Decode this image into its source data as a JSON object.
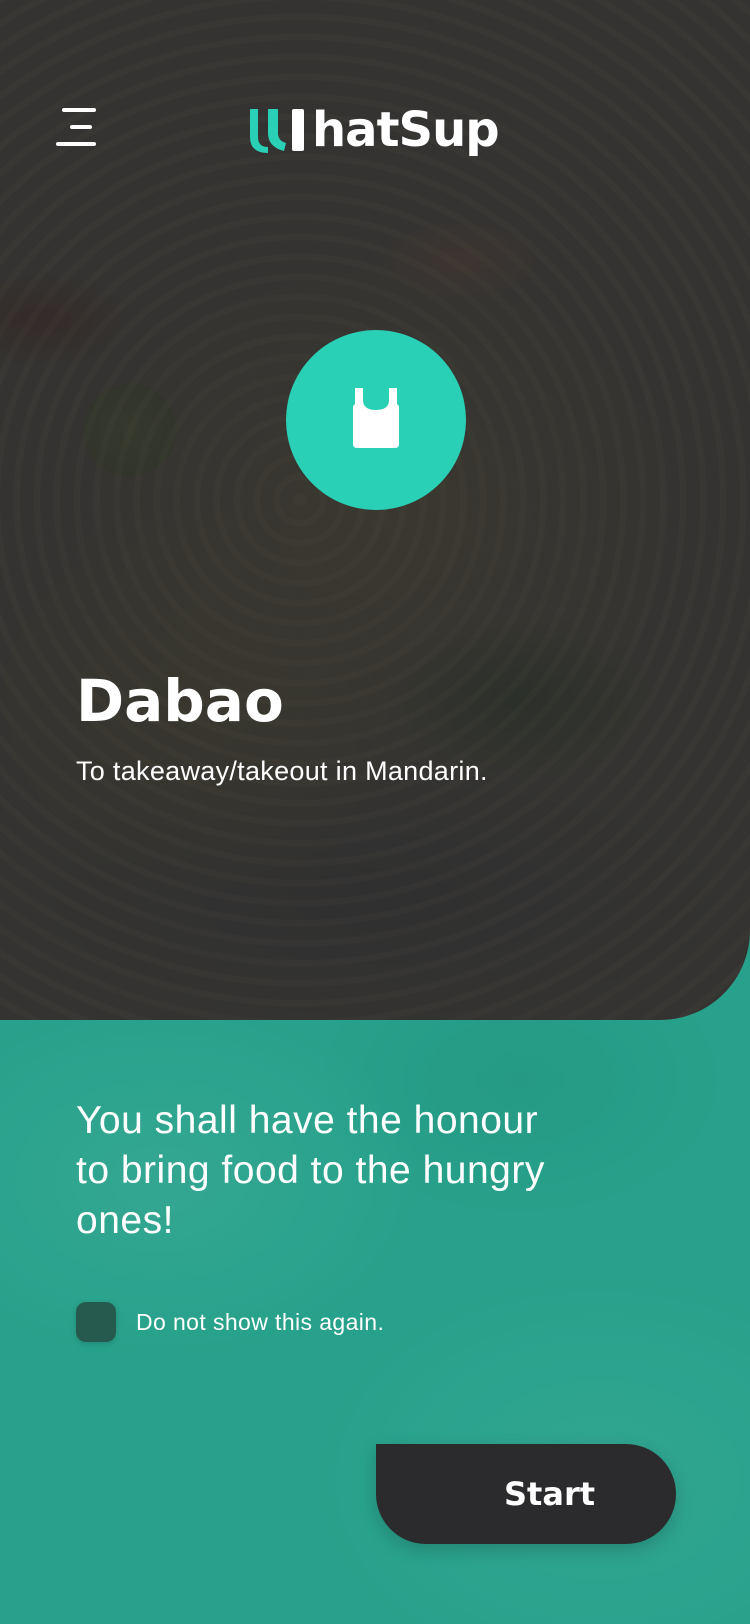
{
  "app": {
    "logo_text": "hatSup",
    "accent_color": "#2ad0b5"
  },
  "header": {
    "menu_icon": "menu-icon",
    "logo_icon": "logo-w-mark"
  },
  "hero": {
    "badge_icon": "shopping-bag-icon",
    "term": "Dabao",
    "definition": "To takeaway/takeout in Mandarin."
  },
  "onboarding": {
    "message": "You shall have the honour to bring food to the hungry ones!",
    "checkbox_label": "Do not show this again.",
    "checkbox_checked": false,
    "start_label": "Start"
  }
}
